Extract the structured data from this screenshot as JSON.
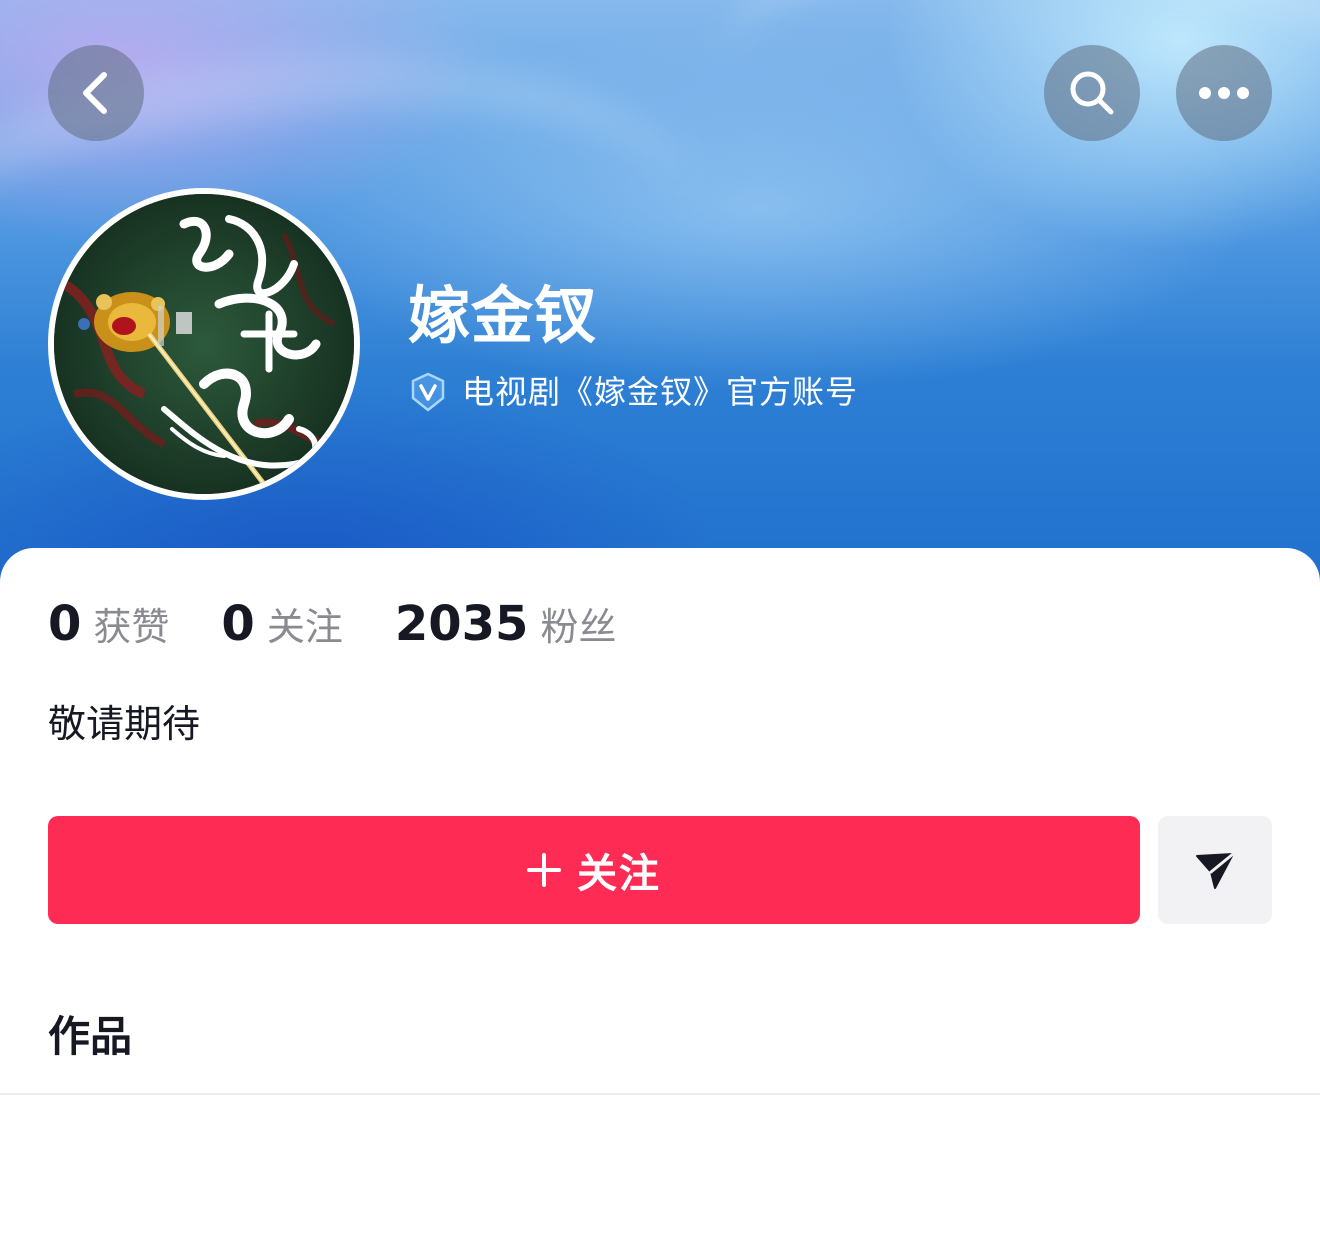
{
  "header": {
    "back_icon": "chevron-left-icon",
    "search_icon": "search-icon",
    "more_icon": "more-horizontal-icon"
  },
  "profile": {
    "name": "嫁金钗",
    "verified_icon": "verified-badge-icon",
    "verified_text": "电视剧《嫁金钗》官方账号",
    "avatar_icon": "poster-avatar",
    "bio": "敬请期待"
  },
  "stats": [
    {
      "value": "0",
      "label": "获赞"
    },
    {
      "value": "0",
      "label": "关注"
    },
    {
      "value": "2035",
      "label": "粉丝"
    }
  ],
  "actions": {
    "follow_label": "关注",
    "follow_color": "#fe2c55",
    "share_icon": "send-icon"
  },
  "sections": {
    "works_title": "作品"
  }
}
